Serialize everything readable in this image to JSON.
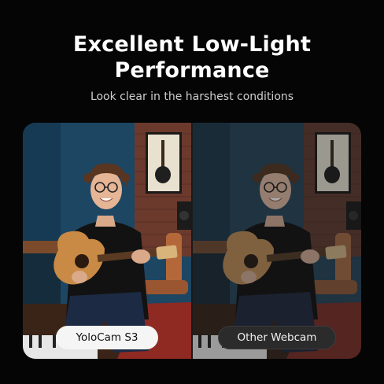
{
  "headline": {
    "line1": "Excellent Low-Light",
    "line2": "Performance"
  },
  "subtitle": "Look clear in the harshest conditions",
  "comparison": {
    "left_label": "YoloCam S3",
    "right_label": "Other Webcam"
  },
  "colors": {
    "background": "#050505",
    "wall_blue": "#1d4663",
    "brick": "#6b3a2c",
    "guitar": "#c98a45",
    "chair": "#b4683a",
    "rug": "#8e2a22"
  }
}
